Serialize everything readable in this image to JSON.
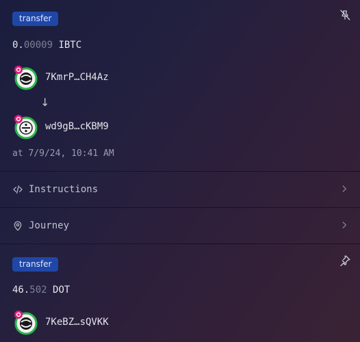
{
  "transactions": [
    {
      "badge": "transfer",
      "amount_whole": "0.",
      "amount_fraction": "00009",
      "amount_symbol": " IBTC",
      "from_address": "7KmrP…CH4Az",
      "arrow": "↓",
      "to_address": "wd9gB…cKBM9",
      "timestamp": "at 7/9/24, 10:41 AM",
      "pinned": false
    },
    {
      "badge": "transfer",
      "amount_whole": "46.",
      "amount_fraction": "502",
      "amount_symbol": " DOT",
      "from_address": "7KeBZ…sQVKK",
      "pinned": true
    }
  ],
  "menu": {
    "instructions_label": "Instructions",
    "journey_label": "Journey"
  },
  "colors": {
    "badge_bg": "#1f47a8",
    "avatar_ring": "#2bb34a",
    "network_dot": "#e6177a"
  },
  "icons": {
    "pin_off": "pin-off-icon",
    "pin": "pin-icon",
    "code": "code-icon",
    "location": "map-pin-icon",
    "chevron": "chevron-right-icon",
    "polkadot": "polkadot-network-icon"
  }
}
